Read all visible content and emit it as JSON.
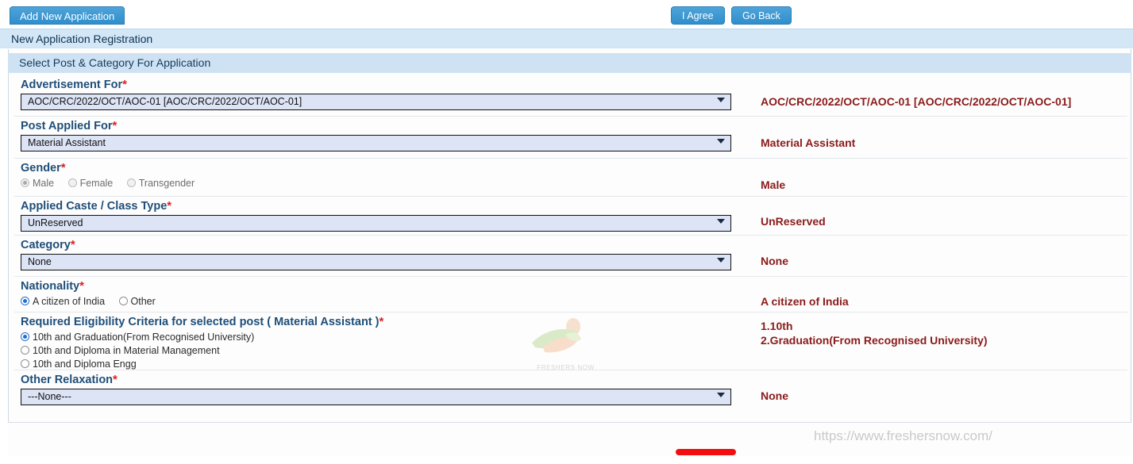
{
  "tab": {
    "label": "Add New Application"
  },
  "banner": {
    "main": "New Application Registration",
    "sub": "Select Post & Category For Application"
  },
  "fields": {
    "advertisement": {
      "label": "Advertisement For",
      "value": "AOC/CRC/2022/OCT/AOC-01 [AOC/CRC/2022/OCT/AOC-01]",
      "summary": "AOC/CRC/2022/OCT/AOC-01 [AOC/CRC/2022/OCT/AOC-01]"
    },
    "post": {
      "label": "Post Applied For",
      "value": "Material Assistant",
      "summary": "Material Assistant"
    },
    "gender": {
      "label": "Gender",
      "options": [
        {
          "label": "Male",
          "selected": true,
          "disabled": true
        },
        {
          "label": "Female",
          "selected": false,
          "disabled": true
        },
        {
          "label": "Transgender",
          "selected": false,
          "disabled": true
        }
      ],
      "summary": "Male"
    },
    "caste": {
      "label": "Applied Caste / Class Type",
      "value": "UnReserved",
      "summary": "UnReserved"
    },
    "category": {
      "label": "Category",
      "value": "None",
      "summary": "None"
    },
    "nationality": {
      "label": "Nationality",
      "options": [
        {
          "label": "A citizen of India",
          "selected": true,
          "disabled": false
        },
        {
          "label": "Other",
          "selected": false,
          "disabled": false
        }
      ],
      "summary": "A citizen of India"
    },
    "eligibility": {
      "label": "Required Eligibility Criteria for selected post ( Material Assistant )",
      "options": [
        {
          "label": "10th and Graduation(From Recognised University)",
          "selected": true
        },
        {
          "label": "10th and Diploma in Material Management",
          "selected": false
        },
        {
          "label": "10th and Diploma Engg",
          "selected": false
        }
      ],
      "summary_line1": "1.10th",
      "summary_line2": "2.Graduation(From Recognised University)"
    },
    "relaxation": {
      "label": "Other Relaxation",
      "value": "---None---",
      "summary": "None"
    }
  },
  "footer": {
    "agree_label": "I Agree",
    "back_label": "Go Back",
    "watermark_url": "https://www.freshersnow.com/"
  },
  "watermark": {
    "text": "FRESHERS NOW"
  },
  "colors": {
    "tab_blue": "#2f8fcc",
    "banner_main": "#d3e7f7",
    "banner_sub": "#cfe2f4",
    "label_blue": "#1f4e79",
    "required_red": "#e02020",
    "summary_maroon": "#8b1a1a",
    "select_bg": "#dde4f5",
    "highlight_red": "#f30f0f"
  }
}
